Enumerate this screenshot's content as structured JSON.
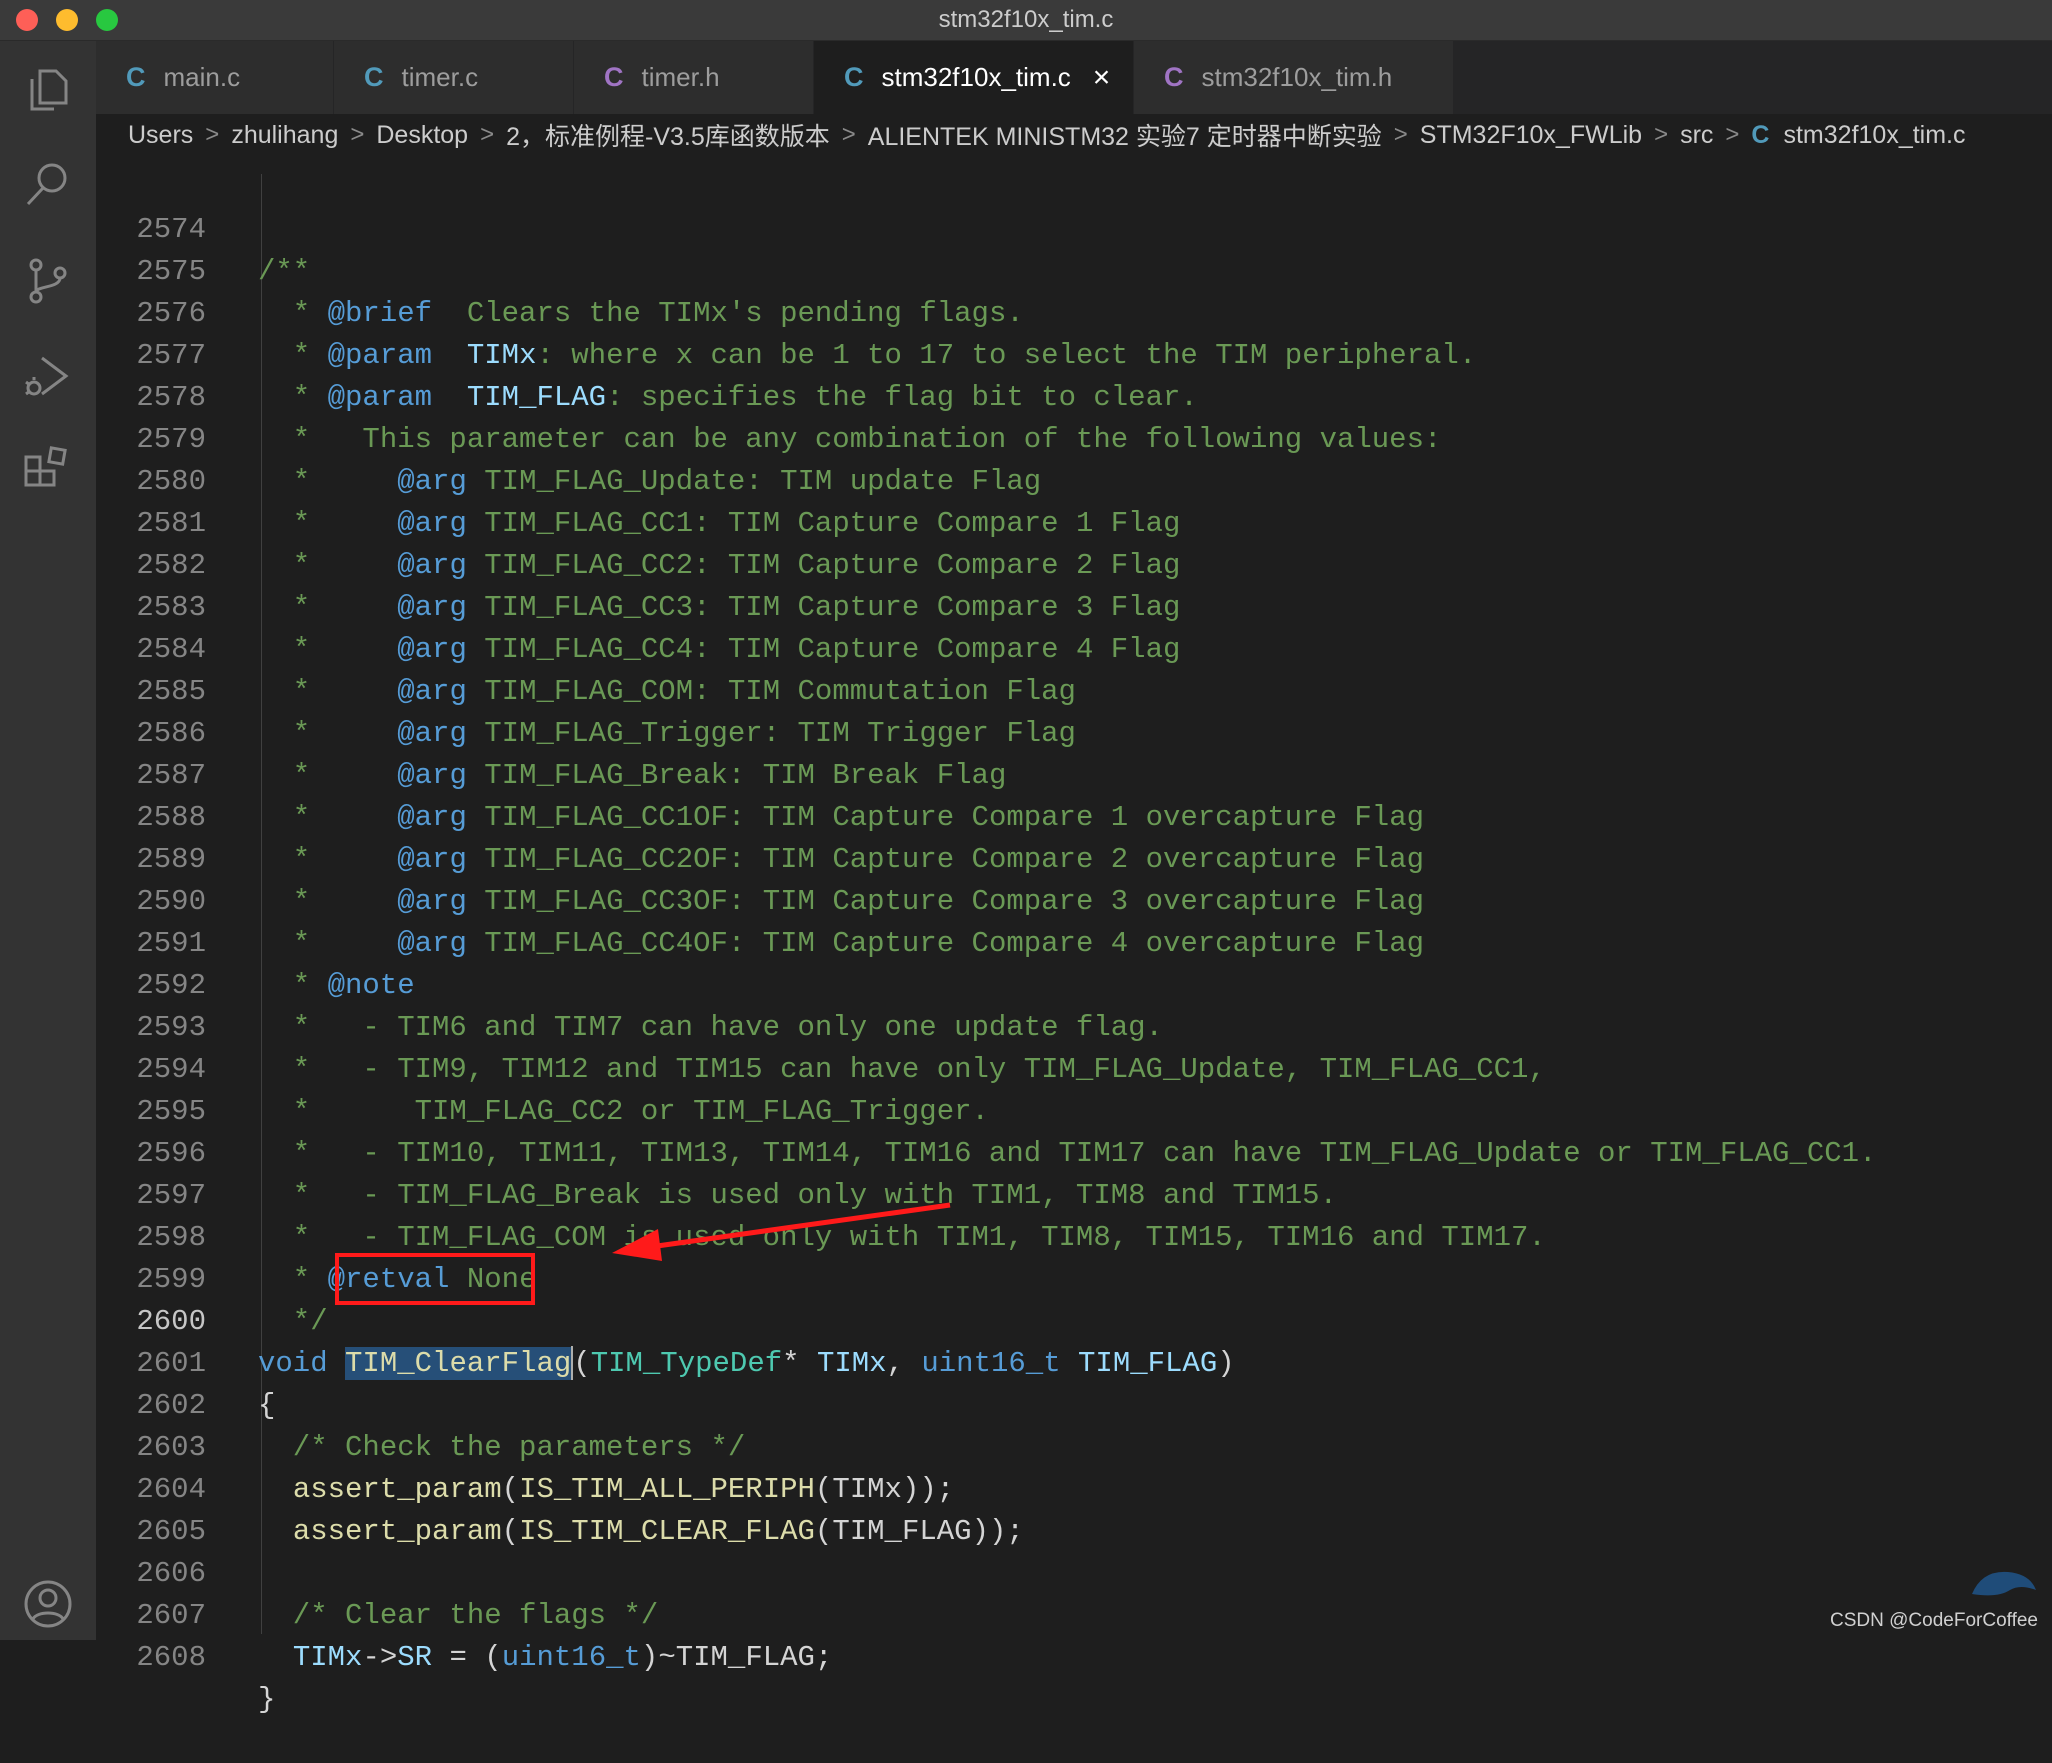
{
  "window": {
    "title": "stm32f10x_tim.c"
  },
  "tabs": [
    {
      "icon": "C",
      "label": "main.c",
      "type": "c"
    },
    {
      "icon": "C",
      "label": "timer.c",
      "type": "c"
    },
    {
      "icon": "C",
      "label": "timer.h",
      "type": "h"
    },
    {
      "icon": "C",
      "label": "stm32f10x_tim.c",
      "type": "c",
      "active": true,
      "close": "×"
    },
    {
      "icon": "C",
      "label": "stm32f10x_tim.h",
      "type": "h"
    }
  ],
  "breadcrumb": {
    "items": [
      "Users",
      "zhulihang",
      "Desktop",
      "2，标准例程-V3.5库函数版本",
      "ALIENTEK MINISTM32 实验7 定时器中断实验",
      "STM32F10x_FWLib",
      "src"
    ],
    "file_icon": "C",
    "file": "stm32f10x_tim.c",
    "separator": ">"
  },
  "editor": {
    "current_line": "2600",
    "line_numbers": [
      "2574",
      "2575",
      "2576",
      "2577",
      "2578",
      "2579",
      "2580",
      "2581",
      "2582",
      "2583",
      "2584",
      "2585",
      "2586",
      "2587",
      "2588",
      "2589",
      "2590",
      "2591",
      "2592",
      "2593",
      "2594",
      "2595",
      "2596",
      "2597",
      "2598",
      "2599",
      "2600",
      "2601",
      "2602",
      "2603",
      "2604",
      "2605",
      "2606",
      "2607",
      "2608"
    ],
    "lines": {
      "l2574": "/**",
      "l2575": {
        "star": "  * ",
        "tag": "@brief",
        "text": "  Clears the TIMx's pending flags."
      },
      "l2576": {
        "star": "  * ",
        "tag": "@param",
        "sp": "  ",
        "param": "TIMx",
        "text": ": where x can be 1 to 17 to select the TIM peripheral."
      },
      "l2577": {
        "star": "  * ",
        "tag": "@param",
        "sp": "  ",
        "param": "TIM_FLAG",
        "text": ": specifies the flag bit to clear."
      },
      "l2578": "  *   This parameter can be any combination of the following values:",
      "args": [
        "TIM_FLAG_Update: TIM update Flag",
        "TIM_FLAG_CC1: TIM Capture Compare 1 Flag",
        "TIM_FLAG_CC2: TIM Capture Compare 2 Flag",
        "TIM_FLAG_CC3: TIM Capture Compare 3 Flag",
        "TIM_FLAG_CC4: TIM Capture Compare 4 Flag",
        "TIM_FLAG_COM: TIM Commutation Flag",
        "TIM_FLAG_Trigger: TIM Trigger Flag",
        "TIM_FLAG_Break: TIM Break Flag",
        "TIM_FLAG_CC1OF: TIM Capture Compare 1 overcapture Flag",
        "TIM_FLAG_CC2OF: TIM Capture Compare 2 overcapture Flag",
        "TIM_FLAG_CC3OF: TIM Capture Compare 3 overcapture Flag",
        "TIM_FLAG_CC4OF: TIM Capture Compare 4 overcapture Flag"
      ],
      "arg_prefix": "  *     ",
      "arg_tag": "@arg",
      "l2591": {
        "star": "  * ",
        "tag": "@note"
      },
      "l2592": "  *   - TIM6 and TIM7 can have only one update flag.",
      "l2593": "  *   - TIM9, TIM12 and TIM15 can have only TIM_FLAG_Update, TIM_FLAG_CC1,",
      "l2594": "  *      TIM_FLAG_CC2 or TIM_FLAG_Trigger.",
      "l2595": "  *   - TIM10, TIM11, TIM13, TIM14, TIM16 and TIM17 can have TIM_FLAG_Update or TIM_FLAG_CC1.",
      "l2596": "  *   - TIM_FLAG_Break is used only with TIM1, TIM8 and TIM15.",
      "l2597": "  *   - TIM_FLAG_COM is used only with TIM1, TIM8, TIM15, TIM16 and TIM17.",
      "l2598": {
        "star": "  * ",
        "tag": "@retval",
        "text": " None"
      },
      "l2599": "  */",
      "l2600": {
        "kw": "void",
        "fn": "TIM_ClearFlag",
        "open": "(",
        "type": "TIM_TypeDef",
        "ptr": "* ",
        "p1": "TIMx",
        "comma": ", ",
        "type2": "uint16_t",
        "p2": "TIM_FLAG",
        "close": ")"
      },
      "l2601": "{",
      "l2602": "  /* Check the parameters */",
      "l2603": {
        "indent": "  ",
        "fn": "assert_param",
        "o1": "(",
        "macro": "IS_TIM_ALL_PERIPH",
        "o2": "(",
        "arg": "TIMx",
        "end": "));"
      },
      "l2604": {
        "indent": "  ",
        "fn": "assert_param",
        "o1": "(",
        "macro": "IS_TIM_CLEAR_FLAG",
        "o2": "(",
        "arg": "TIM_FLAG",
        "end": "));"
      },
      "l2606": "  /* Clear the flags */",
      "l2607": {
        "indent": "  ",
        "var": "TIMx",
        "arrow": "->",
        "field": "SR",
        "eq": " = (",
        "type": "uint16_t",
        "rest": ")~TIM_FLAG;"
      },
      "l2608": "}"
    }
  },
  "colors": {
    "comment": "#6a9955",
    "doc_tag": "#569cd6",
    "param": "#9cdcfe",
    "keyword": "#569cd6",
    "function": "#dcdcaa",
    "annotation": "#ff1a1a"
  },
  "watermark": "CSDN @CodeForCoffee"
}
